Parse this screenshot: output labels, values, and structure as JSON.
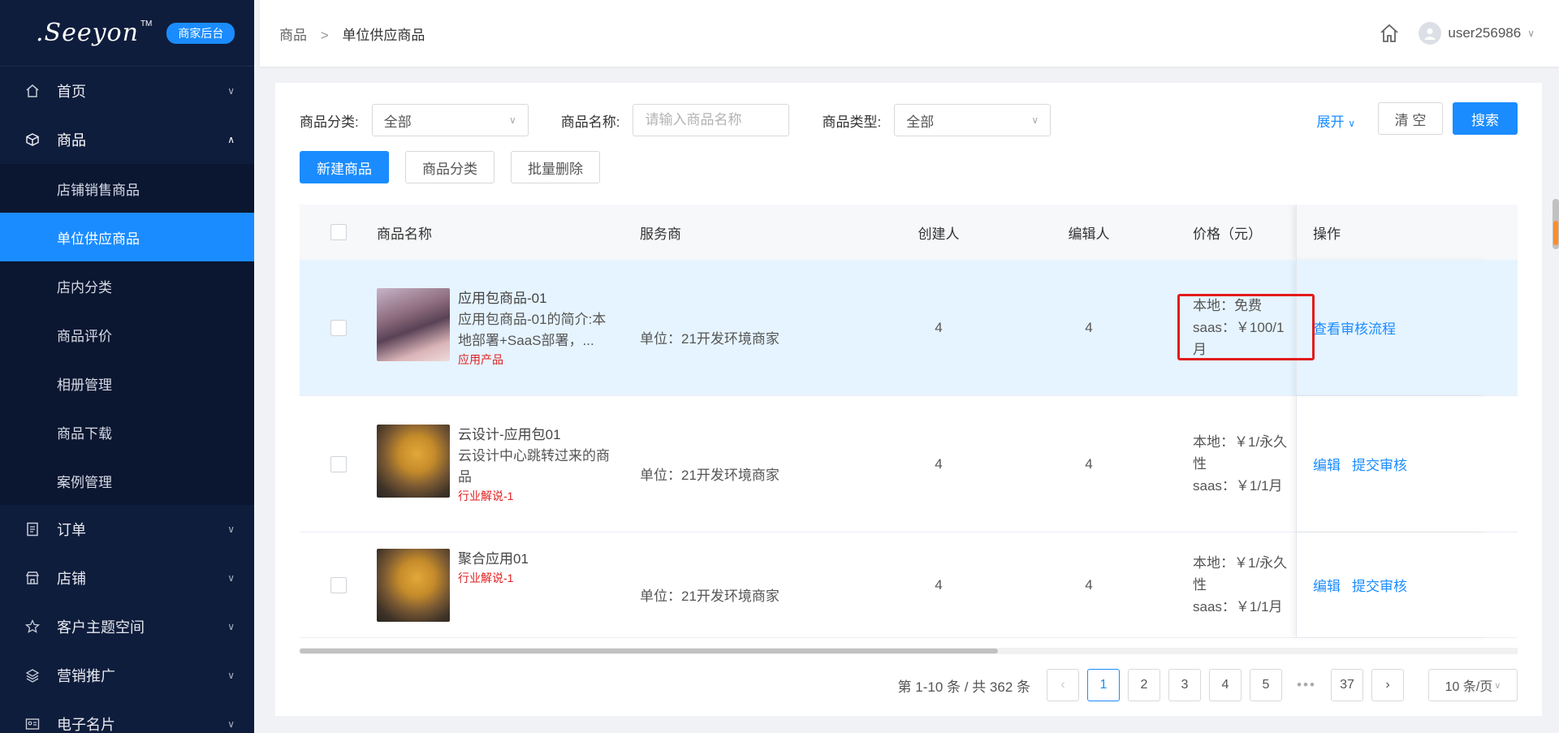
{
  "brand": {
    "logo": ".Seeyon",
    "tm": "TM",
    "badge": "商家后台"
  },
  "sidebar": {
    "items": [
      {
        "label": "首页",
        "icon": "home-icon",
        "expanded": false
      },
      {
        "label": "商品",
        "icon": "cube-icon",
        "expanded": true,
        "children": [
          "店铺销售商品",
          "单位供应商品",
          "店内分类",
          "商品评价",
          "相册管理",
          "商品下载",
          "案例管理"
        ],
        "active_child": "单位供应商品"
      },
      {
        "label": "订单",
        "icon": "order-icon",
        "expanded": false
      },
      {
        "label": "店铺",
        "icon": "shop-icon",
        "expanded": false
      },
      {
        "label": "客户主题空间",
        "icon": "star-icon",
        "expanded": false
      },
      {
        "label": "营销推广",
        "icon": "layers-icon",
        "expanded": false
      },
      {
        "label": "电子名片",
        "icon": "card-icon",
        "expanded": false
      }
    ]
  },
  "header": {
    "breadcrumb": [
      "商品",
      "单位供应商品"
    ],
    "separator": ">",
    "username": "user256986"
  },
  "filters": {
    "category_label": "商品分类:",
    "category_value": "全部",
    "name_label": "商品名称:",
    "name_placeholder": "请输入商品名称",
    "type_label": "商品类型:",
    "type_value": "全部",
    "expand_label": "展开",
    "clear_label": "清 空",
    "search_label": "搜索"
  },
  "toolbar": {
    "new_label": "新建商品",
    "category_label": "商品分类",
    "batch_delete_label": "批量删除"
  },
  "table": {
    "columns": [
      "商品名称",
      "服务商",
      "创建人",
      "编辑人",
      "价格（元）",
      "操作"
    ],
    "rows": [
      {
        "title": "应用包商品-01",
        "desc": "应用包商品-01的简介:本地部署+SaaS部署，...",
        "tag": "应用产品",
        "thumb": "anime",
        "provider": "单位：21开发环境商家",
        "creator": "4",
        "editor": "4",
        "price_local": "本地：免费",
        "price_saas": "saas：￥100/1月",
        "ops": [
          "查看审核流程"
        ],
        "highlighted": true
      },
      {
        "title": "云设计-应用包01",
        "desc": "云设计中心跳转过来的商品",
        "tag": "行业解说-1",
        "thumb": "bear",
        "provider": "单位：21开发环境商家",
        "creator": "4",
        "editor": "4",
        "price_local": "本地：￥1/永久性",
        "price_saas": "saas：￥1/1月",
        "ops": [
          "编辑",
          "提交审核"
        ],
        "highlighted": false
      },
      {
        "title": "聚合应用01",
        "desc": "",
        "tag": "行业解说-1",
        "thumb": "bear",
        "provider": "单位：21开发环境商家",
        "creator": "4",
        "editor": "4",
        "price_local": "本地：￥1/永久性",
        "price_saas": "saas：￥1/1月",
        "ops": [
          "编辑",
          "提交审核"
        ],
        "highlighted": false
      }
    ]
  },
  "pagination": {
    "total_text": "第 1-10 条 / 共 362 条",
    "pages": [
      "1",
      "2",
      "3",
      "4",
      "5"
    ],
    "dots": "•••",
    "last_page": "37",
    "current": "1",
    "page_size": "10 条/页"
  },
  "colors": {
    "primary": "#1a8cff",
    "sidebar_bg": "#0f1d3c",
    "highlight_row": "#e6f4ff",
    "annotation_red": "#e21b1b"
  }
}
